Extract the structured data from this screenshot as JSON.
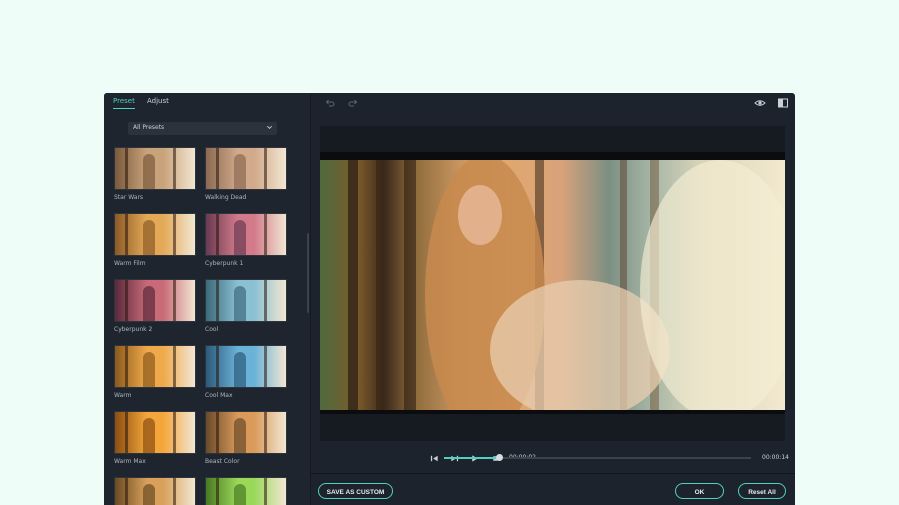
{
  "tabs": [
    {
      "label": "Preset"
    },
    {
      "label": "Adjust"
    }
  ],
  "preset_filter": {
    "selected": "All Presets"
  },
  "presets": [
    {
      "label": "Star Wars",
      "tint": "#c8a27a",
      "tint2": "#7a5a3c"
    },
    {
      "label": "Walking Dead",
      "tint": "#d2a98a",
      "tint2": "#8a6a52"
    },
    {
      "label": "Warm Film",
      "tint": "#e3a957",
      "tint2": "#8b5a26"
    },
    {
      "label": "Cyberpunk 1",
      "tint": "#d27a8a",
      "tint2": "#6a3a52"
    },
    {
      "label": "Cyberpunk 2",
      "tint": "#c86a78",
      "tint2": "#5a2a3c"
    },
    {
      "label": "Cool",
      "tint": "#8ac0d2",
      "tint2": "#3c6a7a"
    },
    {
      "label": "Warm",
      "tint": "#f0a94a",
      "tint2": "#8a5a1c"
    },
    {
      "label": "Cool Max",
      "tint": "#6ab2d8",
      "tint2": "#2c5a7a"
    },
    {
      "label": "Warm Max",
      "tint": "#f5a63a",
      "tint2": "#8a4e12"
    },
    {
      "label": "Beast Color",
      "tint": "#d99a5a",
      "tint2": "#6a4a2a"
    },
    {
      "label": "",
      "tint": "#d8a05a",
      "tint2": "#6a4a22"
    },
    {
      "label": "",
      "tint": "#9ad85a",
      "tint2": "#4a7a22"
    }
  ],
  "player": {
    "current_time": "00:00:02",
    "total_time": "00:00:14",
    "progress": 0.18
  },
  "buttons": {
    "save_custom": "SAVE AS CUSTOM",
    "ok": "OK",
    "reset": "Reset All"
  },
  "colors": {
    "accent": "#4fd1c1",
    "panel": "#1e252e",
    "page_bg": "#effdf9"
  }
}
